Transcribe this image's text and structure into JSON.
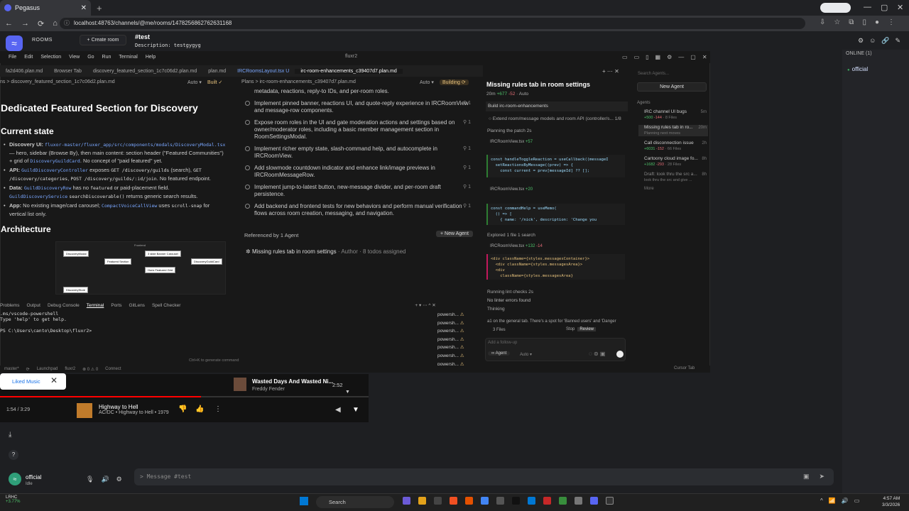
{
  "browser": {
    "tab_title": "Pegasus",
    "url": "localhost:48763/channels/@me/rooms/1478256862762631168"
  },
  "discord": {
    "rooms_label": "ROOMS",
    "create_room": "+ Create room",
    "channel_title": "#test",
    "channel_desc": "Description: testgygyg",
    "online_header": "ONLINE (1)",
    "member": "official",
    "user_name": "official",
    "user_status": "Idle",
    "message_placeholder": "> Message #test"
  },
  "vscode": {
    "menu": [
      "File",
      "Edit",
      "Selection",
      "View",
      "Go",
      "Run",
      "Terminal",
      "Help"
    ],
    "window_title": "fluxr2",
    "tabs": [
      {
        "label": "fa2d406.plan.md",
        "active": false
      },
      {
        "label": "Browser Tab",
        "active": false
      },
      {
        "label": "discovery_featured_section_1c7c06d2.plan.md",
        "active": false
      },
      {
        "label": "plan.md",
        "active": false
      },
      {
        "label": "IRCRoomsLayout.tsx U",
        "active": false
      },
      {
        "label": "irc-room-enhancements_c39407d7.plan.md",
        "active": true
      }
    ],
    "left_breadcrumb": "ns > discovery_featured_section_1c7c06d2.plan.md",
    "left_auto": "Auto ▾",
    "left_built": "Built ✓",
    "doc_title": "Dedicated Featured Section for Discovery",
    "current_state": "Current state",
    "architecture": "Architecture",
    "diagram": {
      "frontend": "Frontend",
      "n1": "DiscoveryModal",
      "n2": "Featured Section",
      "n3": "3 slide Banner Carousel",
      "n4": "Horiz Featured Grid",
      "n5": "DiscoveryGuildCard",
      "n6": "DiscoveryStore"
    },
    "mid_breadcrumb": "Plans > irc-room-enhancements_c39407d7.plan.md",
    "mid_auto": "Auto ▾",
    "mid_building": "Building ⟳",
    "todos": [
      "metadata, reactions, reply-to IDs, and per-room roles.",
      "Implement pinned banner, reactions UI, and quote-reply experience in IRCRoomView and message-row components.",
      "Expose room roles in the UI and gate moderation actions and settings based on owner/moderator roles, including a basic member management section in RoomSettingsModal.",
      "Implement richer empty state, slash-command help, and autocomplete in IRCRoomView.",
      "Add slowmode countdown indicator and enhance link/image previews in IRCRoomMessageRow.",
      "Implement jump-to-latest button, new-message divider, and per-room draft persistence.",
      "Add backend and frontend tests for new behaviors and perform manual verification flows across room creation, messaging, and navigation."
    ],
    "ref_header": "Referenced by 1 Agent",
    "new_agent_btn": "+ New Agent",
    "ref_item": "Missing rules tab in room settings",
    "ref_meta": "· Author · 8 todos assigned",
    "term_tabs": [
      "Problems",
      "Output",
      "Debug Console",
      "Terminal",
      "Ports",
      "GitLens",
      "Spell Checker"
    ],
    "term_lines": [
      ".ms/vscode-powershell",
      "Type 'help' to get help.",
      "",
      "PS C:\\Users\\canto\\Desktop\\fluxr2>"
    ],
    "term_list": [
      "powersh...",
      "powersh...",
      "powersh...",
      "powersh...",
      "powersh...",
      "powersh...",
      "powersh..."
    ],
    "status_items": [
      "master*",
      "⟳",
      "Launchpad",
      "fluxr2",
      "⊗ 0 ⚠ 0",
      "Connect"
    ],
    "cmd_hint": "Ctrl+K to generate command",
    "cursor_tab": "Cursor Tab"
  },
  "agent": {
    "title": "Missing rules tab in room settings",
    "time": "20m",
    "add": "+677",
    "del": "-52",
    "mode": "Auto",
    "build_row": "Build  irc-room-enhancements",
    "extend": "Extend room/message models and room API (controller/s...   1/8",
    "planning": "Planning the patch 2s",
    "file1": "IRCRoomView.tsx",
    "file1_add": "+57",
    "code1": "const handleToggleReaction = useCallback((messageI\n  setReactionsByMessage((prev) => {\n    const current = prev[messageId] ?? [];",
    "file2": "IRCRoomView.tsx",
    "file2_add": "+20",
    "code2": "const commandHelp = useMemo(\n  () => [\n    { name: '/nick', description: 'Change you",
    "explored": "Explored 1 file 1 search",
    "file3": "IRCRoomView.tsx",
    "file3_add": "+132",
    "file3_del": "-14",
    "code3": "<div className={styles.messagesContainer}>\n  <div className={styles.messagesArea}>\n  <div\n    className={styles.messagesArea}",
    "lint": "Running lint checks 2s",
    "no_lint": "No linter errors found",
    "thinking": "Thinking",
    "thinking_text": "a1  on the general tab. There's a spot for 'Banned users' and 'Danger",
    "files_count": "3 Files",
    "stop": "Stop",
    "review": "Review",
    "followup": "Add a follow-up",
    "agent_mode": "∞ Agent",
    "auto_mode": "Auto ▾"
  },
  "agent_list": {
    "search": "Search Agents...",
    "new_agent": "New Agent",
    "header": "Agents",
    "items": [
      {
        "title": "IRC channel UI bugs",
        "time": "5m",
        "sub_add": "+500",
        "sub_del": "-144",
        "sub": "· 8 Files"
      },
      {
        "title": "Missing rules tab in ro...",
        "time": "20m",
        "sub": "Planning next moves"
      },
      {
        "title": "Call disconnection issue",
        "time": "2h",
        "sub_add": "+6031",
        "sub_del": "-152",
        "sub": "· 66 Files"
      },
      {
        "title": "Cartoony cloud image fo...",
        "time": "8h",
        "sub_add": "+1682",
        "sub_del": "-293",
        "sub": "· 28 Files"
      },
      {
        "title": "Draft: look thru the src a...",
        "time": "8h",
        "sub": "look thru the src and give ..."
      }
    ],
    "more": "More"
  },
  "player": {
    "liked": "Liked Music",
    "upnext_title": "Wasted Days And Wasted Ni...",
    "upnext_artist": "Freddy Fender",
    "upnext_duration": "2:52",
    "timecode": "1:54 / 3:29",
    "track_title": "Highway to Hell",
    "track_sub": "AC/DC • Highway to Hell • 1979",
    "progress": 0.545
  },
  "taskbar": {
    "ticker": "LRHC",
    "ticker_change": "+3.77%",
    "search": "Search",
    "time": "4:57 AM",
    "date": "3/3/2026"
  }
}
